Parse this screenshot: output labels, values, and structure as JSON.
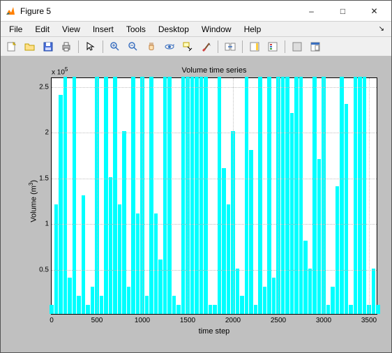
{
  "window": {
    "title": "Figure 5",
    "buttons": {
      "minimize": "–",
      "maximize": "□",
      "close": "✕"
    }
  },
  "menu": {
    "items": [
      "File",
      "Edit",
      "View",
      "Insert",
      "Tools",
      "Desktop",
      "Window",
      "Help"
    ]
  },
  "toolbar": {
    "new": "new-figure-icon",
    "open": "open-file-icon",
    "save": "save-icon",
    "print": "print-icon",
    "pointer": "pointer-icon",
    "zoom_in": "zoom-in-icon",
    "zoom_out": "zoom-out-icon",
    "pan": "pan-icon",
    "rotate": "rotate3d-icon",
    "datacursor": "data-cursor-icon",
    "brush": "brush-icon",
    "link": "link-plot-icon",
    "colorbar": "colorbar-icon",
    "legend": "legend-icon",
    "hide": "hide-tools-icon",
    "dock": "dock-icon"
  },
  "chart_data": {
    "type": "line",
    "title": "Volume time series",
    "xlabel": "time step",
    "ylabel": "Volume (m³)",
    "y_exponent_label": "x 10",
    "y_exponent_power": "5",
    "xlim": [
      0,
      3600
    ],
    "ylim": [
      0,
      2.6
    ],
    "xticks": [
      0,
      500,
      1000,
      1500,
      2000,
      2500,
      3000,
      3500
    ],
    "yticks": [
      0.5,
      1,
      1.5,
      2,
      2.5
    ],
    "xtick_labels": [
      "0",
      "500",
      "1000",
      "1500",
      "2000",
      "2500",
      "3000",
      "3500"
    ],
    "ytick_labels": [
      "0.5",
      "1",
      "1.5",
      "2",
      "2.5"
    ],
    "grid": true,
    "color": "#00ffff",
    "series_note": "Dense noisy line spanning ~3600 time steps; values oscillate between ~0 and ~2.6e5. Representative downsampled values below (y in units of 1e5).",
    "x": [
      0,
      50,
      100,
      150,
      200,
      250,
      300,
      350,
      400,
      450,
      500,
      550,
      600,
      650,
      700,
      750,
      800,
      850,
      900,
      950,
      1000,
      1050,
      1100,
      1150,
      1200,
      1250,
      1300,
      1350,
      1400,
      1450,
      1500,
      1550,
      1600,
      1650,
      1700,
      1750,
      1800,
      1850,
      1900,
      1950,
      2000,
      2050,
      2100,
      2150,
      2200,
      2250,
      2300,
      2350,
      2400,
      2450,
      2500,
      2550,
      2600,
      2650,
      2700,
      2750,
      2800,
      2850,
      2900,
      2950,
      3000,
      3050,
      3100,
      3150,
      3200,
      3250,
      3300,
      3350,
      3400,
      3450,
      3500,
      3550,
      3600
    ],
    "y": [
      0.1,
      1.2,
      2.4,
      2.6,
      0.4,
      2.6,
      0.2,
      1.3,
      0.1,
      0.3,
      2.6,
      0.2,
      2.6,
      1.5,
      2.6,
      1.2,
      2.0,
      0.3,
      2.6,
      1.1,
      2.6,
      0.2,
      2.6,
      1.1,
      0.6,
      2.6,
      2.6,
      0.2,
      0.1,
      2.6,
      2.6,
      2.6,
      2.6,
      2.6,
      2.6,
      0.1,
      0.1,
      2.6,
      1.6,
      1.2,
      2.0,
      0.5,
      0.2,
      2.6,
      1.8,
      0.1,
      2.6,
      0.3,
      2.6,
      0.4,
      2.6,
      2.6,
      2.6,
      2.2,
      2.6,
      2.6,
      0.8,
      0.5,
      2.6,
      1.7,
      2.6,
      0.1,
      0.3,
      1.4,
      2.6,
      2.3,
      0.1,
      2.6,
      2.6,
      2.6,
      0.1,
      0.5,
      0.1
    ]
  }
}
